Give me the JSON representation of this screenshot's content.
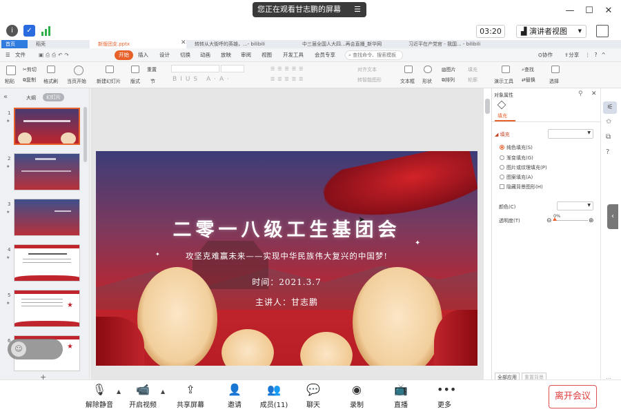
{
  "meeting": {
    "share_banner": "您正在观看甘志鹏的屏幕",
    "timer": "03:20",
    "presenter_view": "演讲者视图",
    "bottom": [
      {
        "label": "解除静音",
        "icon": "mic-muted-icon"
      },
      {
        "label": "开启视频",
        "icon": "video-off-icon"
      },
      {
        "label": "共享屏幕",
        "icon": "share-screen-icon"
      },
      {
        "label": "邀请",
        "icon": "invite-icon"
      },
      {
        "label": "成员(11)",
        "icon": "members-icon"
      },
      {
        "label": "聊天",
        "icon": "chat-icon"
      },
      {
        "label": "录制",
        "icon": "record-icon"
      },
      {
        "label": "直播",
        "icon": "live-icon"
      },
      {
        "label": "更多",
        "icon": "more-icon"
      }
    ],
    "leave": "离开会议"
  },
  "wps": {
    "tabs": [
      "首页",
      "稻壳",
      "新版团支.pptx",
      "转转从大街呼的英雄，...- bilibili",
      "中三届全国人大四...再会直播_新华网",
      "习近平在产党官 - 我国... - bilibili"
    ],
    "menus": [
      "文件",
      "开始",
      "插入",
      "设计",
      "切换",
      "动画",
      "放映",
      "审阅",
      "视图",
      "开发工具",
      "会员专享"
    ],
    "search_placeholder": "查找命令、搜索模板",
    "right_menu": [
      "协作",
      "分享"
    ],
    "toolbar": {
      "paste": "粘贴",
      "cut": "剪切",
      "copy": "复制",
      "format_painter": "格式刷",
      "from_current": "当页开始",
      "new_slide": "新建幻灯片",
      "layout": "版式",
      "section": "节",
      "reset": "重置",
      "textbox": "文本框",
      "shape": "形状",
      "image": "图片",
      "arrange": "排列",
      "fill": "填充",
      "outline": "轮廓",
      "presenter_tools": "演示工具",
      "find": "查找",
      "replace": "替换",
      "select": "选择",
      "align_text": "对齐文本",
      "convert_smartart": "转智能图形"
    },
    "left_tabs": {
      "outline": "大纲",
      "slides": "幻灯片"
    },
    "slide_numbers": [
      "1",
      "2",
      "3",
      "4",
      "5",
      "6"
    ],
    "slide": {
      "title": "二零一八级工生基团会",
      "subtitle": "攻坚克难赢未来——实现中华民族伟大复兴的中国梦!",
      "time": "时间：2021.3.7",
      "speaker": "主讲人：甘志鹏"
    },
    "props": {
      "header": "对象属性",
      "tab": "填充",
      "section": "填充",
      "options": [
        "纯色填充(S)",
        "渐变填充(G)",
        "图片或纹理填充(P)",
        "图案填充(A)"
      ],
      "hide_bg": "隐藏背景图形(H)",
      "color_label": "颜色(C)",
      "transparency_label": "透明度(T)",
      "transparency_value": "0%",
      "apply_all": "全部应用",
      "reset_bg": "重置背景"
    }
  },
  "colors": {
    "accent": "#e8612b",
    "slide_red": "#c0242c",
    "leave_red": "#e03a3a"
  }
}
